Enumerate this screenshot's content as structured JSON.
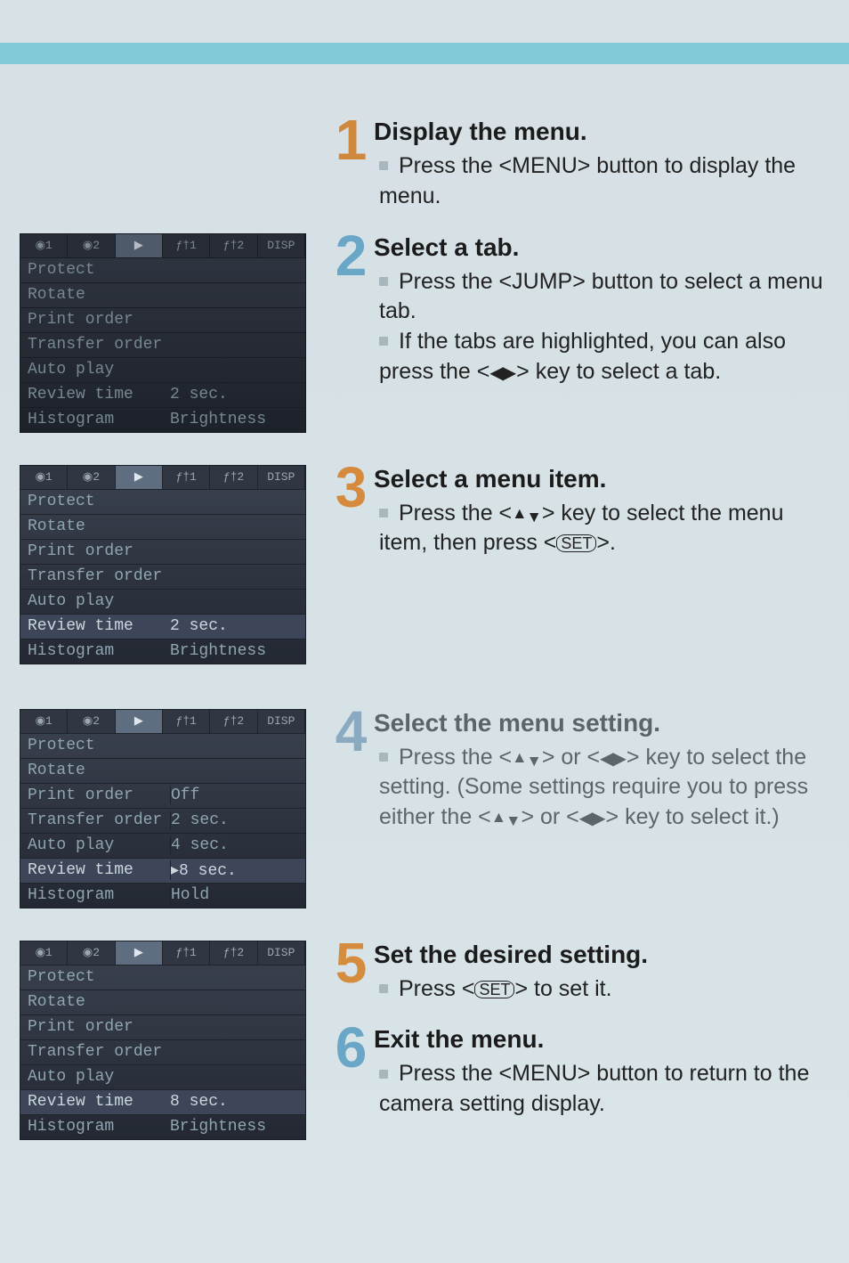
{
  "steps": [
    {
      "num": "1",
      "title": "Display the menu.",
      "bullets": [
        "Press the <MENU> button to display the menu."
      ]
    },
    {
      "num": "2",
      "title": "Select a tab.",
      "bullets": [
        "Press the <JUMP> button to select a menu tab.",
        "If the tabs are highlighted, you can also press the <◀▶> key to select a tab."
      ]
    },
    {
      "num": "3",
      "title": "Select a menu item.",
      "bullets": [
        "Press the <▲▼> key to select the menu item, then press <SET>."
      ]
    },
    {
      "num": "4",
      "title": "Select the menu setting.",
      "faded": true,
      "bullets": [
        "Press the <▲▼> or <◀▶> key to select the setting. (Some settings require you to press either the <▲▼> or <◀▶> key to select it.)"
      ]
    },
    {
      "num": "5",
      "title": "Set the desired setting.",
      "bullets": [
        "Press <SET> to set it."
      ]
    },
    {
      "num": "6",
      "title": "Exit the menu.",
      "bullets": [
        "Press the <MENU> button to return to the camera setting display."
      ]
    }
  ],
  "menu": {
    "tabs": [
      "◉1",
      "◉2",
      "▶",
      "ƒ†1",
      "ƒ†2",
      "DISP"
    ],
    "items": [
      "Protect",
      "Rotate",
      "Print order",
      "Transfer order",
      "Auto play",
      "Review time",
      "Histogram"
    ],
    "review_value": "2 sec.",
    "histogram_value": "Brightness",
    "screen4_options": [
      "Off",
      "2 sec.",
      "4 sec.",
      "▸8 sec.",
      "Hold"
    ],
    "screen5_review": "8 sec."
  }
}
